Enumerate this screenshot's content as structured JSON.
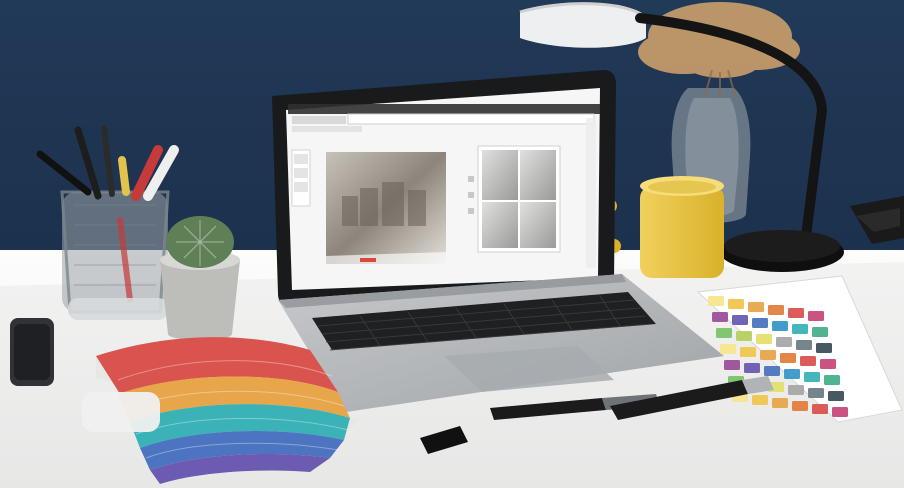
{
  "scene": {
    "kind": "photograph",
    "objects": [
      "desk",
      "laptop",
      "laptop-screen-ui",
      "keyboard",
      "trackpad",
      "pen-holder",
      "cactus-pot",
      "desk-lamp",
      "dried-flower-vase",
      "yellow-mug",
      "color-fan-deck",
      "color-swatch-card",
      "markers",
      "smartphone"
    ]
  },
  "colors": {
    "wall": "#1f3552",
    "desk": "#f2f2f0",
    "laptop_body": "#b9bcc0",
    "laptop_bezel": "#1b1c1e",
    "screen_bg": "#f7f7f7",
    "mug": "#f2cf45",
    "lamp": "#1a1a1a",
    "cactus": "#5f7f57",
    "pot": "#bdbdba",
    "vase_flowers": "#c49a6b",
    "marker_black": "#1b1b1b",
    "marker_gray": "#6f7378"
  },
  "swatch_palette": [
    "#f7e58e",
    "#f1c54f",
    "#e7a64a",
    "#e37f3d",
    "#d9534f",
    "#c74a7a",
    "#9c4f9a",
    "#6c5bb0",
    "#4c74c0",
    "#3a97c7",
    "#3bb3b6",
    "#48b08a",
    "#7cc36a",
    "#b5cf5e",
    "#e2e06a",
    "#a8a8a8",
    "#6f7d86",
    "#3e4f5b"
  ]
}
